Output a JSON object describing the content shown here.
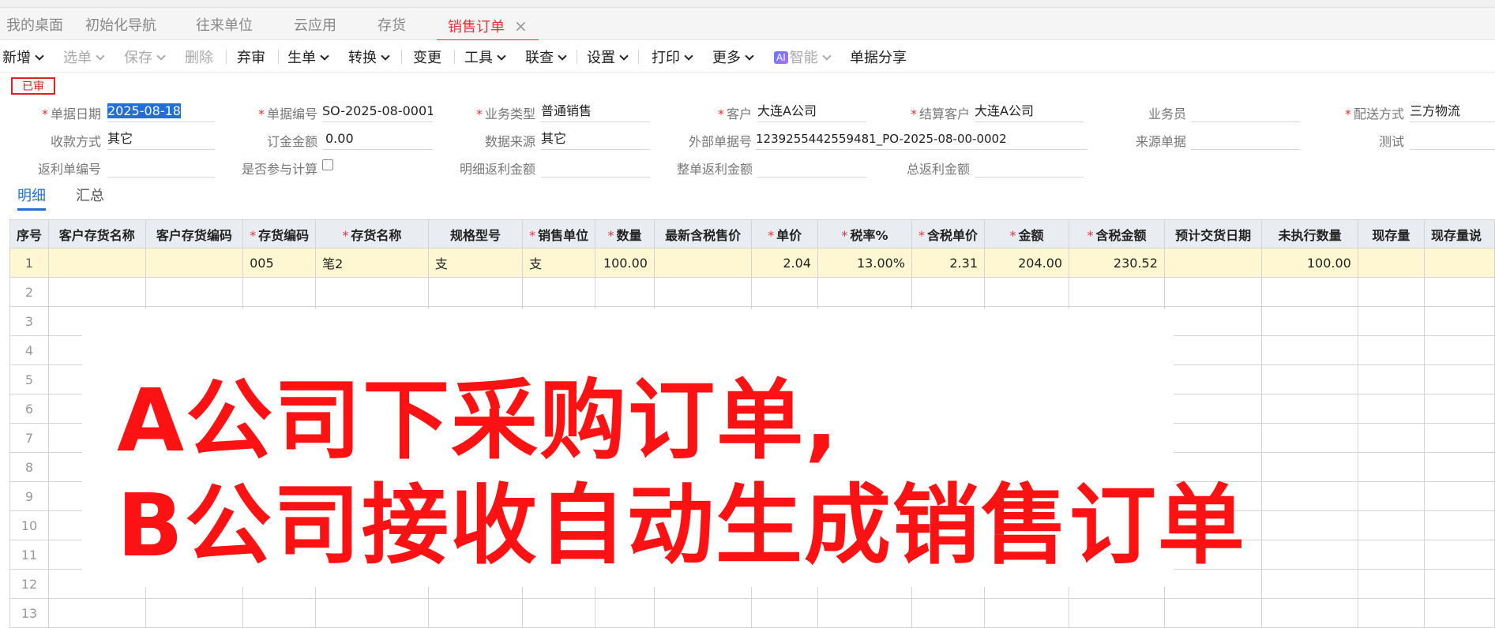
{
  "tabs": [
    {
      "label": "我的桌面"
    },
    {
      "label": "初始化导航"
    },
    {
      "label": "往来单位"
    },
    {
      "label": "云应用"
    },
    {
      "label": "存货"
    },
    {
      "label": "销售订单"
    }
  ],
  "active_tab_close": "×",
  "toolbar": {
    "items": [
      "新增",
      "选单",
      "保存",
      "删除",
      "弃审",
      "生单",
      "转换",
      "变更",
      "工具",
      "联查",
      "设置",
      "打印",
      "更多",
      "智能",
      "单据分享"
    ],
    "ai_badge": "AI"
  },
  "status_badge": "已审",
  "form": {
    "date_label": "单据日期",
    "date_value": "2025-08-18",
    "code_label": "单据编号",
    "code_value": "SO-2025-08-0001",
    "biztype_label": "业务类型",
    "biztype_value": "普通销售",
    "customer_label": "客户",
    "customer_value": "大连A公司",
    "settle_customer_label": "结算客户",
    "settle_customer_value": "大连A公司",
    "salesman_label": "业务员",
    "salesman_value": "",
    "delivery_label": "配送方式",
    "delivery_value": "三方物流",
    "payment_label": "收款方式",
    "payment_value": "其它",
    "deposit_label": "订金金额",
    "deposit_value": "0.00",
    "source_label": "数据来源",
    "source_value": "其它",
    "external_no_label": "外部单据号",
    "external_no_value": "1239255442559481_PO-2025-08-00-0002",
    "source_doc_label": "来源单据",
    "source_doc_value": "",
    "test_label": "测试",
    "test_value": "",
    "rebate_no_label": "返利单编号",
    "rebate_no_value": "",
    "calc_label": "是否参与计算",
    "detail_rebate_label": "明细返利金额",
    "detail_rebate_value": "",
    "whole_rebate_label": "整单返利金额",
    "whole_rebate_value": "",
    "total_rebate_label": "总返利金额",
    "total_rebate_value": ""
  },
  "subtabs": [
    "明细",
    "汇总"
  ],
  "grid": {
    "columns": [
      "序号",
      "客户存货名称",
      "客户存货编码",
      "存货编码",
      "存货名称",
      "规格型号",
      "销售单位",
      "数量",
      "最新含税售价",
      "单价",
      "税率%",
      "含税单价",
      "金额",
      "含税金额",
      "预计交货日期",
      "未执行数量",
      "现存量",
      "现存量说"
    ],
    "rows": [
      [
        "1",
        "",
        "",
        "005",
        "笔2",
        "支",
        "支",
        "100.00",
        "",
        "2.04",
        "13.00%",
        "2.31",
        "204.00",
        "230.52",
        "",
        "100.00",
        "",
        ""
      ]
    ],
    "empty_rows": [
      "2",
      "3",
      "4",
      "5",
      "6",
      "7",
      "8",
      "9",
      "10",
      "11",
      "12",
      "13"
    ]
  },
  "overlay": {
    "line1": "A公司下采购订单,",
    "line2": "B公司接收自动生成销售订单"
  },
  "colors": {
    "accent_red": "#e8333a",
    "overlay_red": "#fc1212",
    "link_blue": "#1f6fd6",
    "highlight_row": "#fff7d1"
  }
}
